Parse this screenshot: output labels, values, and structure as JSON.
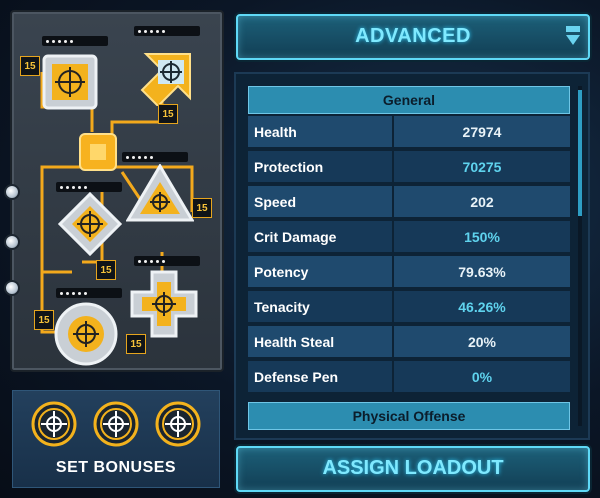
{
  "header": {
    "title": "ADVANCED",
    "dropdown_icon": "chevron-down-icon"
  },
  "mods": [
    {
      "slot": "square",
      "level": "15",
      "dots": 5,
      "icon": "crosshair-icon"
    },
    {
      "slot": "arrow",
      "level": "15",
      "dots": 5,
      "icon": "crosshair-icon"
    },
    {
      "slot": "diamond",
      "level": "15",
      "dots": 5,
      "icon": "crosshair-icon"
    },
    {
      "slot": "triangle",
      "level": "15",
      "dots": 5,
      "icon": "crosshair-icon"
    },
    {
      "slot": "circle",
      "level": "15",
      "dots": 5,
      "icon": "crosshair-icon"
    },
    {
      "slot": "cross",
      "level": "15",
      "dots": 5,
      "icon": "crosshair-icon"
    }
  ],
  "set_bonuses": {
    "title": "SET BONUSES",
    "icons": [
      "crosshair-icon",
      "crosshair-icon",
      "crosshair-icon"
    ]
  },
  "stats": {
    "sections": [
      {
        "title": "General",
        "rows": [
          {
            "name": "Health",
            "value": "27974",
            "color": "white"
          },
          {
            "name": "Protection",
            "value": "70275",
            "color": "cyan"
          },
          {
            "name": "Speed",
            "value": "202",
            "color": "white"
          },
          {
            "name": "Crit Damage",
            "value": "150%",
            "color": "cyan"
          },
          {
            "name": "Potency",
            "value": "79.63%",
            "color": "white"
          },
          {
            "name": "Tenacity",
            "value": "46.26%",
            "color": "cyan"
          },
          {
            "name": "Health Steal",
            "value": "20%",
            "color": "white"
          },
          {
            "name": "Defense Pen",
            "value": "0%",
            "color": "cyan"
          }
        ]
      },
      {
        "title": "Physical Offense",
        "rows": []
      }
    ]
  },
  "footer": {
    "assign_label": "ASSIGN LOADOUT"
  },
  "colors": {
    "gold": "#f3a91c",
    "cyan": "#5fd9f7",
    "panel_blue": "#2c8db0"
  }
}
